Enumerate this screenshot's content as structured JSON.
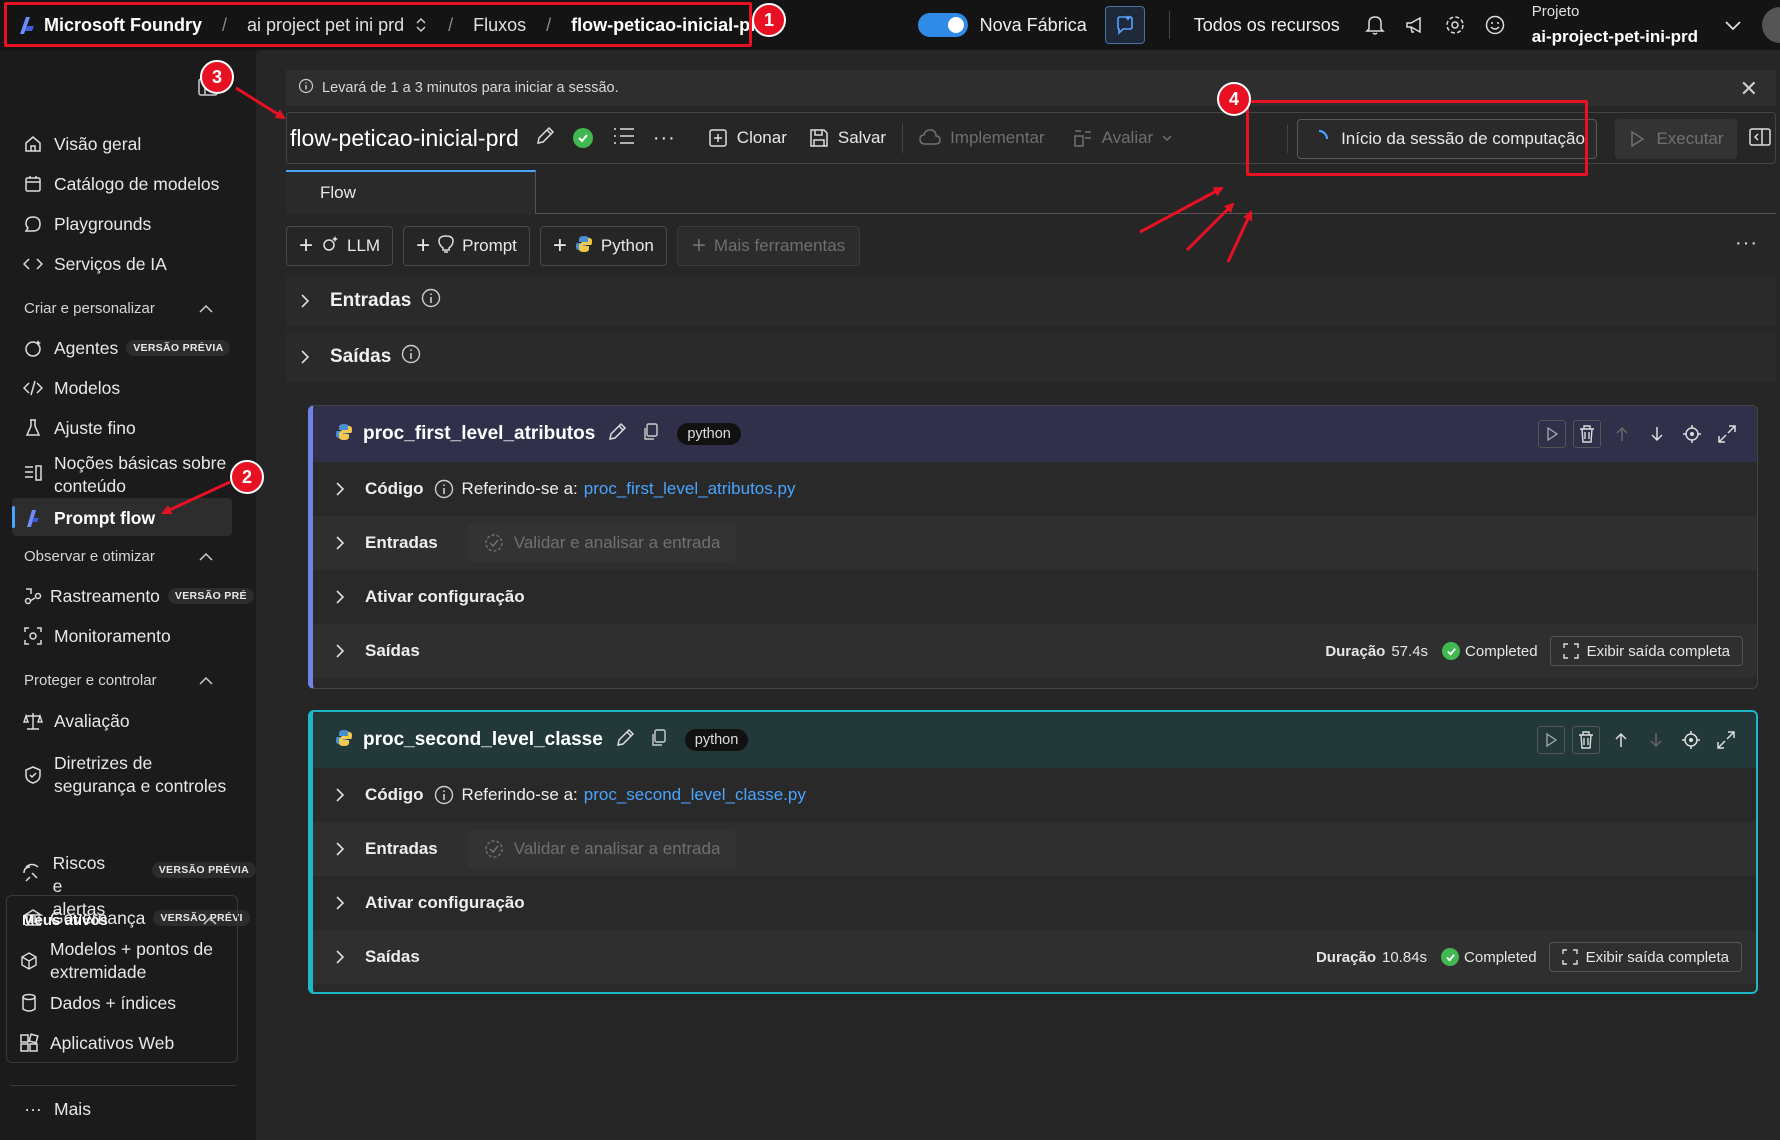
{
  "topbar": {
    "brand": "Microsoft Foundry",
    "project_crumb": "ai project pet ini prd",
    "flows_crumb": "Fluxos",
    "flow_crumb": "flow-peticao-inicial-prd",
    "toggle_label": "Nova Fábrica",
    "all_resources": "Todos os recursos",
    "project_label": "Projeto",
    "project_value": "ai-project-pet-ini-prd"
  },
  "sidebar": {
    "items_top": [
      "Visão geral",
      "Catálogo de modelos",
      "Playgrounds",
      "Serviços de IA"
    ],
    "section_build": "Criar e personalizar",
    "agents": "Agentes",
    "preview_badge": "VERSÃO PRÉVIA",
    "models": "Modelos",
    "finetune": "Ajuste fino",
    "grounding_1": "Noções básicas sobre",
    "grounding_2": "conteúdo",
    "prompt_flow": "Prompt flow",
    "section_observe": "Observar e otimizar",
    "tracing": "Rastreamento",
    "tracing_badge": "VERSÃO PRÉ",
    "monitoring": "Monitoramento",
    "section_protect": "Proteger e controlar",
    "evaluation": "Avaliação",
    "guardrails_1": "Diretrizes de",
    "guardrails_2": "segurança e controles",
    "risks_1": "Riscos e",
    "risks_2": "alertas",
    "governance": "Governança",
    "governance_badge": "VERSÃO PRÉVI",
    "section_assets": "Meus ativos",
    "models_endpoints_1": "Modelos + pontos de",
    "models_endpoints_2": "extremidade",
    "data_indexes": "Dados + índices",
    "web_apps": "Aplicativos Web",
    "more": "Mais"
  },
  "main": {
    "session_msg": "Levará de 1 a 3 minutos para iniciar a sessão.",
    "flow_title": "flow-peticao-inicial-prd",
    "clone": "Clonar",
    "save": "Salvar",
    "deploy": "Implementar",
    "evaluate": "Avaliar",
    "compute_session": "Início da sessão de computação",
    "run": "Executar",
    "tab_flow": "Flow",
    "tools": {
      "llm": "LLM",
      "prompt": "Prompt",
      "python": "Python",
      "more": "Mais ferramentas"
    },
    "inputs_section": "Entradas",
    "outputs_section": "Saídas"
  },
  "nodes": [
    {
      "name": "proc_first_level_atributos",
      "badge": "python",
      "code_label": "Código",
      "ref_label": "Referindo-se a:",
      "file": "proc_first_level_atributos.py",
      "inputs_label": "Entradas",
      "validate": "Validar e analisar a entrada",
      "activate": "Ativar configuração",
      "outputs_label": "Saídas",
      "duration_label": "Duração",
      "duration": "57.4s",
      "status": "Completed",
      "view_full": "Exibir saída completa"
    },
    {
      "name": "proc_second_level_classe",
      "badge": "python",
      "code_label": "Código",
      "ref_label": "Referindo-se a:",
      "file": "proc_second_level_classe.py",
      "inputs_label": "Entradas",
      "validate": "Validar e analisar a entrada",
      "activate": "Ativar configuração",
      "outputs_label": "Saídas",
      "duration_label": "Duração",
      "duration": "10.84s",
      "status": "Completed",
      "view_full": "Exibir saída completa"
    }
  ],
  "annotations": {
    "n1": "1",
    "n2": "2",
    "n3": "3",
    "n4": "4",
    "color": "#e81123"
  }
}
